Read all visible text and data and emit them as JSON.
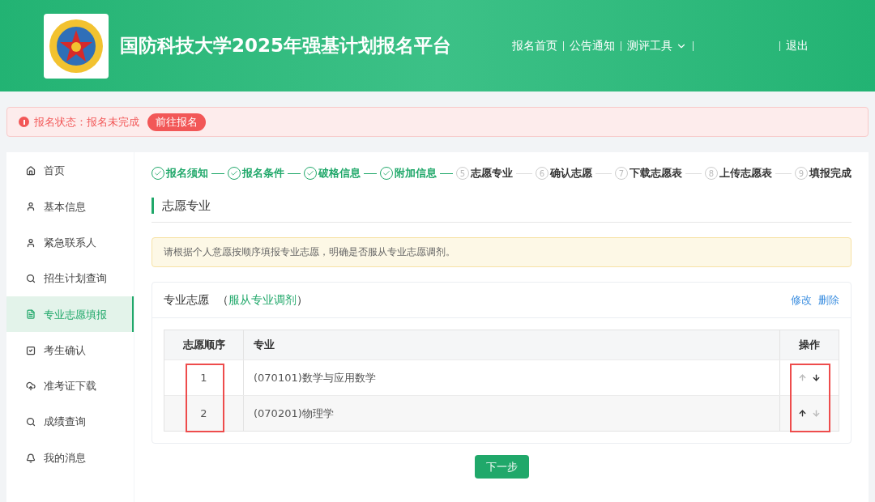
{
  "header": {
    "title": "国防科技大学2025年强基计划报名平台",
    "nav": [
      {
        "label": "报名首页",
        "kind": "link"
      },
      {
        "label": "公告通知",
        "kind": "link"
      },
      {
        "label": "测评工具",
        "kind": "dropdown"
      },
      {
        "kind": "blank"
      },
      {
        "label": "退出",
        "kind": "link"
      }
    ]
  },
  "alert": {
    "text": "报名状态：报名未完成",
    "button": "前往报名"
  },
  "sidebar": {
    "items": [
      {
        "label": "首页",
        "selected": false
      },
      {
        "label": "基本信息",
        "selected": false
      },
      {
        "label": "紧急联系人",
        "selected": false
      },
      {
        "label": "招生计划查询",
        "selected": false
      },
      {
        "label": "专业志愿填报",
        "selected": true
      },
      {
        "label": "考生确认",
        "selected": false
      },
      {
        "label": "准考证下载",
        "selected": false
      },
      {
        "label": "成绩查询",
        "selected": false
      },
      {
        "label": "我的消息",
        "selected": false
      }
    ]
  },
  "steps": [
    {
      "label": "报名须知",
      "done": true
    },
    {
      "label": "报名条件",
      "done": true
    },
    {
      "label": "破格信息",
      "done": true
    },
    {
      "label": "附加信息",
      "done": true
    },
    {
      "number": "5",
      "label": "志愿专业",
      "done": false
    },
    {
      "number": "6",
      "label": "确认志愿",
      "done": false
    },
    {
      "number": "7",
      "label": "下载志愿表",
      "done": false
    },
    {
      "number": "8",
      "label": "上传志愿表",
      "done": false
    },
    {
      "number": "9",
      "label": "填报完成",
      "done": false
    }
  ],
  "section_title": "志愿专业",
  "notice": "请根据个人意愿按顺序填报专业志愿，明确是否服从专业志愿调剂。",
  "card": {
    "title": "专业志愿",
    "bracket_open": "（",
    "adjust": "服从专业调剂",
    "bracket_close": "）",
    "actions": [
      "修改",
      "删除"
    ],
    "table": {
      "columns": [
        {
          "label": "志愿顺序",
          "highlighted": true
        },
        {
          "label": "专业",
          "highlighted": false
        },
        {
          "label": "操作",
          "highlighted": true
        }
      ],
      "rows": [
        {
          "order": "1",
          "major": "(070101)数学与应用数学",
          "up_disabled": true,
          "down_disabled": false
        },
        {
          "order": "2",
          "major": "(070201)物理学",
          "up_disabled": false,
          "down_disabled": true
        }
      ]
    }
  },
  "next_button": "下一步"
}
